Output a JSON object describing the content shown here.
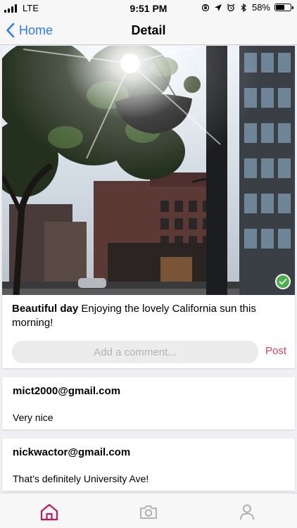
{
  "status_bar": {
    "carrier": "LTE",
    "time": "9:51 PM",
    "battery_percent": "58%",
    "battery_level": 0.58
  },
  "nav": {
    "back_label": "Home",
    "title": "Detail"
  },
  "post": {
    "caption_title": "Beautiful day",
    "caption_text": " Enjoying the lovely California sun this morning!",
    "comment_placeholder": "Add a comment...",
    "post_label": "Post"
  },
  "comments": [
    {
      "author": "mict2000@gmail.com",
      "text": "Very nice"
    },
    {
      "author": "nickwactor@gmail.com",
      "text": "That’s definitely University Ave!"
    }
  ],
  "icons": {
    "back": "chevron-left-icon",
    "verified": "checkmark-icon",
    "home": "home-icon",
    "camera": "camera-icon",
    "profile": "person-icon"
  },
  "colors": {
    "accent_blue": "#2f7af8",
    "post_red": "#e0405f",
    "tab_active": "#c2185b",
    "tab_inactive": "#a9a9ae",
    "verified_green": "#4caf50"
  }
}
